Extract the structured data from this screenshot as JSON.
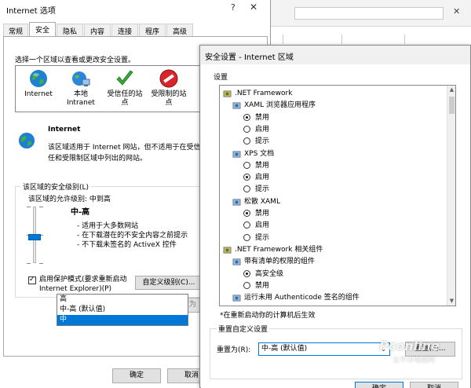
{
  "internet_options": {
    "title": "Internet 选项",
    "help_glyph": "?",
    "close_glyph": "✕",
    "tabs": [
      "常规",
      "安全",
      "隐私",
      "内容",
      "连接",
      "程序",
      "高级"
    ],
    "active_tab": "安全",
    "zone_instruction": "选择一个区域以查看或更改安全设置。",
    "zones": [
      {
        "label": "Internet",
        "icon": "globe-icon",
        "selected": true
      },
      {
        "label": "本地\nIntranet",
        "icon": "network-globe-icon",
        "selected": false
      },
      {
        "label": "受信任的站\n点",
        "icon": "green-check-icon",
        "selected": false
      },
      {
        "label": "受限制的站\n点",
        "icon": "no-entry-icon",
        "selected": false
      }
    ],
    "zone_name": "Internet",
    "zone_description": "该区域适用于 Internet 网站，但不适用于在受信任和受限制区域中列出的网站。",
    "level_group_title": "该区域的安全级别(L)",
    "level_allowed": "该区域的允许级别: 中到高",
    "level_name": "中-高",
    "level_bullets": [
      "- 适用于大多数网站",
      "- 在下载潜在的不安全内容之前提示",
      "- 不下载未签名的 ActiveX 控件"
    ],
    "protected_mode_label": "启用保护模式(要求重新启动 Internet Explorer)(P)",
    "protected_mode_checked": true,
    "custom_level_button": "自定义级别(C)...",
    "reset_all_button": "将所有区域重置为",
    "ok_button": "确定",
    "cancel_button": "取消"
  },
  "security_settings": {
    "title": "安全设置 - Internet 区域",
    "settings_label": "设置",
    "items": [
      {
        "text": ".NET Framework",
        "kind": "category"
      },
      {
        "text": "XAML 浏览器应用程序",
        "kind": "setting"
      },
      {
        "text": "禁用",
        "kind": "option",
        "checked": true
      },
      {
        "text": "启用",
        "kind": "option",
        "checked": false
      },
      {
        "text": "提示",
        "kind": "option",
        "checked": false
      },
      {
        "text": "XPS 文档",
        "kind": "setting"
      },
      {
        "text": "禁用",
        "kind": "option",
        "checked": false
      },
      {
        "text": "启用",
        "kind": "option",
        "checked": true
      },
      {
        "text": "提示",
        "kind": "option",
        "checked": false
      },
      {
        "text": "松散 XAML",
        "kind": "setting"
      },
      {
        "text": "禁用",
        "kind": "option",
        "checked": true
      },
      {
        "text": "启用",
        "kind": "option",
        "checked": false
      },
      {
        "text": "提示",
        "kind": "option",
        "checked": false
      },
      {
        "text": ".NET Framework 相关组件",
        "kind": "category"
      },
      {
        "text": "带有清单的权限的组件",
        "kind": "setting"
      },
      {
        "text": "高安全级",
        "kind": "option",
        "checked": true
      },
      {
        "text": "禁用",
        "kind": "option",
        "checked": false
      },
      {
        "text": "运行未用 Authenticode 签名的组件",
        "kind": "setting"
      }
    ],
    "restart_note": "*在重新启动你的计算机后生效",
    "reset_group_title": "重置自定义设置",
    "reset_to_label": "重置为(R):",
    "reset_select_value": "中-高 (默认值)",
    "reset_options": [
      "高",
      "中-高 (默认值)",
      "中"
    ],
    "reset_selected_option": "中",
    "reset_button": "重置(E)...",
    "ok_button": "确定",
    "cancel_button": "取消"
  },
  "watermark": {
    "text": "Pconline",
    "sub": "太平洋电脑网"
  },
  "colors": {
    "accent": "#0078d7",
    "dialog_bg": "#f0f0f0",
    "panel_bg": "#ffffff"
  }
}
